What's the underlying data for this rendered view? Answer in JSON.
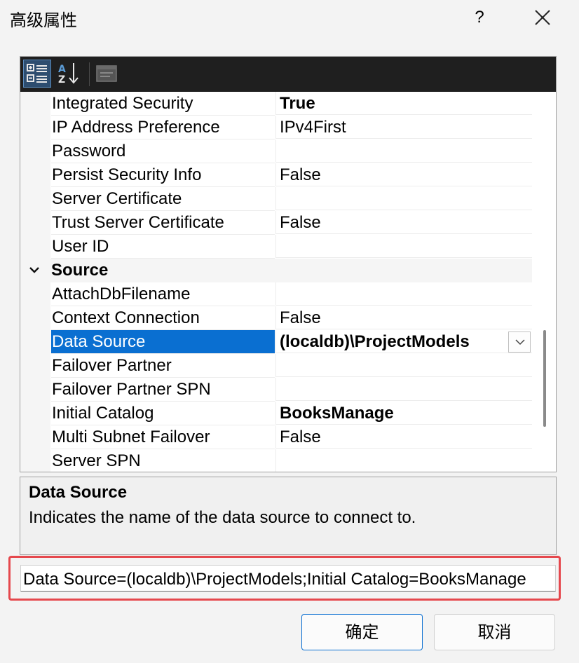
{
  "window": {
    "title": "高级属性",
    "help_label": "?",
    "close_icon": "close-icon"
  },
  "toolbar": {
    "buttons": [
      {
        "icon": "categorized-view-icon",
        "active": true
      },
      {
        "icon": "alphabetical-sort-icon",
        "active": false
      },
      {
        "icon": "property-pages-icon",
        "active": false
      }
    ]
  },
  "property_grid": {
    "rows": [
      {
        "type": "property",
        "name": "Integrated Security",
        "value": "True",
        "bold": true
      },
      {
        "type": "property",
        "name": "IP Address Preference",
        "value": "IPv4First",
        "bold": false
      },
      {
        "type": "property",
        "name": "Password",
        "value": "",
        "bold": false
      },
      {
        "type": "property",
        "name": "Persist Security Info",
        "value": "False",
        "bold": false
      },
      {
        "type": "property",
        "name": "Server Certificate",
        "value": "",
        "bold": false
      },
      {
        "type": "property",
        "name": "Trust Server Certificate",
        "value": "False",
        "bold": false
      },
      {
        "type": "property",
        "name": "User ID",
        "value": "",
        "bold": false
      },
      {
        "type": "category",
        "name": "Source",
        "expanded": true
      },
      {
        "type": "property",
        "name": "AttachDbFilename",
        "value": "",
        "bold": false
      },
      {
        "type": "property",
        "name": "Context Connection",
        "value": "False",
        "bold": false
      },
      {
        "type": "property",
        "name": "Data Source",
        "value": "(localdb)\\ProjectModels",
        "bold": true,
        "selected": true,
        "has_dropdown": true
      },
      {
        "type": "property",
        "name": "Failover Partner",
        "value": "",
        "bold": false
      },
      {
        "type": "property",
        "name": "Failover Partner SPN",
        "value": "",
        "bold": false
      },
      {
        "type": "property",
        "name": "Initial Catalog",
        "value": "BooksManage",
        "bold": true
      },
      {
        "type": "property",
        "name": "Multi Subnet Failover",
        "value": "False",
        "bold": false
      },
      {
        "type": "property",
        "name": "Server SPN",
        "value": "",
        "bold": false
      }
    ]
  },
  "description": {
    "title": "Data Source",
    "text": "Indicates the name of the data source to connect to."
  },
  "connection_string": {
    "value": "Data Source=(localdb)\\ProjectModels;Initial Catalog=BooksManage"
  },
  "buttons": {
    "ok_label": "确定",
    "cancel_label": "取消"
  },
  "colors": {
    "selection": "#0a6fd1",
    "highlight_border": "#e5484d",
    "toolbar_bg": "#1f1f1f"
  }
}
